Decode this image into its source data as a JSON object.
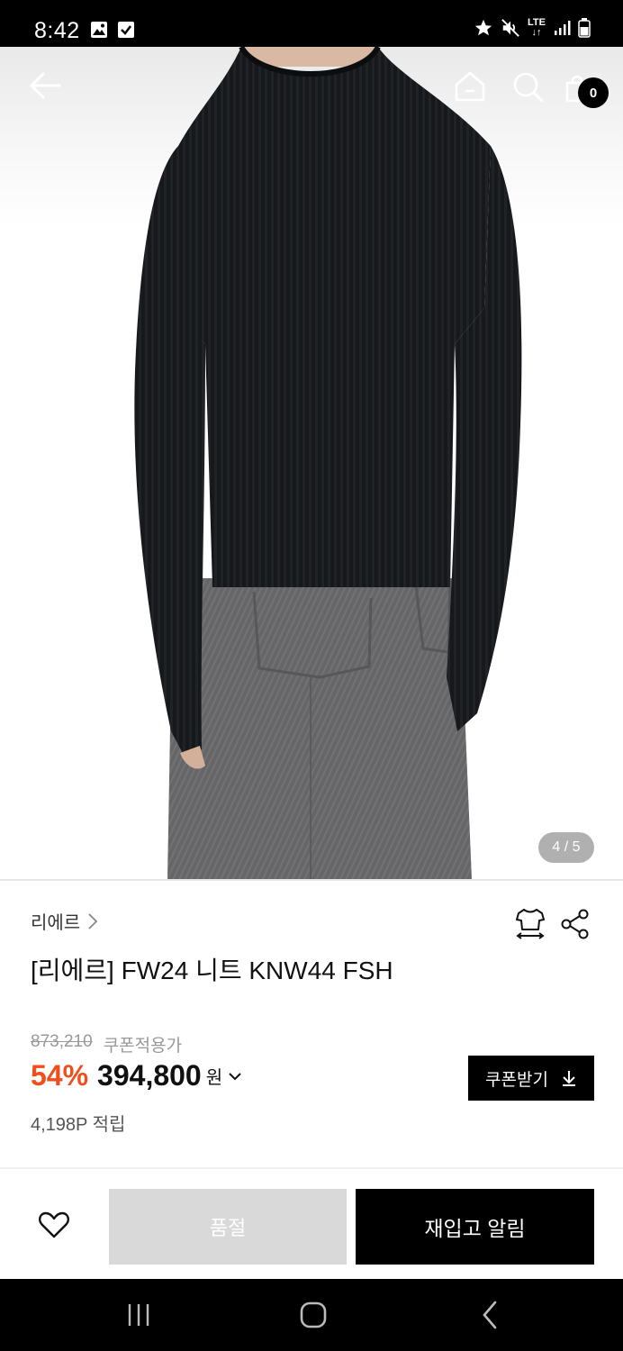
{
  "status_bar": {
    "time": "8:42",
    "left_icons": [
      "gallery-icon",
      "check-icon"
    ],
    "right_icons": [
      "star-icon",
      "mute-icon",
      "lte-icon",
      "signal-icon",
      "battery-icon"
    ],
    "network_label": "LTE"
  },
  "header": {
    "back_icon": "arrow-left-icon",
    "home_icon": "home-icon",
    "search_icon": "search-icon",
    "cart_icon": "cart-icon",
    "cart_count": "0"
  },
  "gallery": {
    "indicator": "4 / 5"
  },
  "product": {
    "brand": "리에르",
    "title": "[리에르] FW24 니트 KNW44 FSH",
    "original_price": "873,210",
    "coupon_price_label": "쿠폰적용가",
    "discount": "54%",
    "price": "394,800",
    "currency": "원",
    "points": "4,198P 적립",
    "coupon_button": "쿠폰받기",
    "discount_color": "#f04e1c"
  },
  "actions": {
    "soldout_label": "품절",
    "restock_label": "재입고 알림"
  }
}
